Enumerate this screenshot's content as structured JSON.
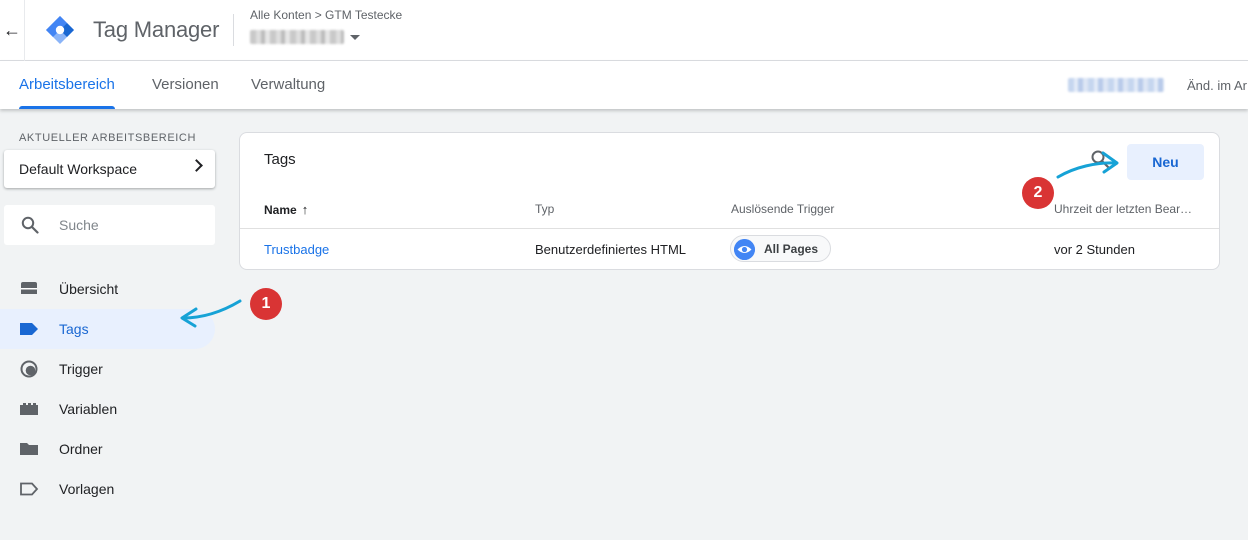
{
  "appbar": {
    "back_label": "←",
    "title": "Tag Manager",
    "breadcrumb": "Alle Konten > GTM Testecke"
  },
  "tabs": [
    {
      "label": "Arbeitsbereich",
      "active": true
    },
    {
      "label": "Versionen",
      "active": false
    },
    {
      "label": "Verwaltung",
      "active": false
    }
  ],
  "tabbar_right_text": "Änd. im Ar",
  "sidebar": {
    "workspace_label": "AKTUELLER ARBEITSBEREICH",
    "workspace_name": "Default Workspace",
    "search_placeholder": "Suche",
    "items": [
      {
        "label": "Übersicht",
        "icon": "overview-icon",
        "active": false
      },
      {
        "label": "Tags",
        "icon": "tag-icon",
        "active": true
      },
      {
        "label": "Trigger",
        "icon": "trigger-icon",
        "active": false
      },
      {
        "label": "Variablen",
        "icon": "variables-icon",
        "active": false
      },
      {
        "label": "Ordner",
        "icon": "folder-icon",
        "active": false
      },
      {
        "label": "Vorlagen",
        "icon": "template-icon",
        "active": false
      }
    ]
  },
  "tags_panel": {
    "title": "Tags",
    "new_button": "Neu",
    "columns": [
      "Name",
      "Typ",
      "Auslösende Trigger",
      "Uhrzeit der letzten Bear…"
    ],
    "sort_arrow": "↑",
    "rows": [
      {
        "name": "Trustbadge",
        "type": "Benutzerdefiniertes HTML",
        "trigger": "All Pages",
        "last_edited": "vor 2 Stunden"
      }
    ]
  },
  "annotations": {
    "badge_1": "1",
    "badge_2": "2",
    "color": "#d93434",
    "arrow_color": "#16a2d6"
  },
  "colors": {
    "accent": "#1a73e8",
    "active_nav_bg": "#e8f0fe",
    "page_bg": "#f1f3f4"
  }
}
